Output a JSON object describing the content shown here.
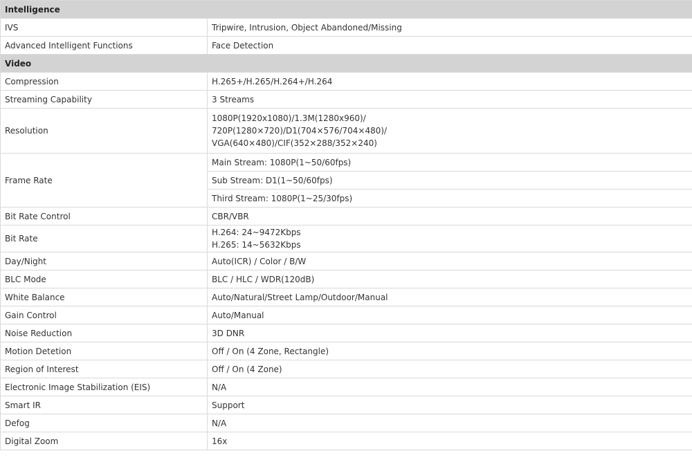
{
  "sections": {
    "intelligence": {
      "title": "Intelligence",
      "rows": [
        {
          "label": "IVS",
          "value": "Tripwire, Intrusion, Object Abandoned/Missing"
        },
        {
          "label": "Advanced Intelligent Functions",
          "value": "Face Detection"
        }
      ]
    },
    "video": {
      "title": "Video",
      "compression": {
        "label": "Compression",
        "value": "H.265+/H.265/H.264+/H.264"
      },
      "streaming": {
        "label": "Streaming Capability",
        "value": "3 Streams"
      },
      "resolution": {
        "label": "Resolution",
        "lines": [
          "1080P(1920x1080)/1.3M(1280x960)/",
          "720P(1280×720)/D1(704×576/704×480)/",
          "VGA(640×480)/CIF(352×288/352×240)"
        ]
      },
      "frame_rate": {
        "label": "Frame Rate",
        "values": [
          "Main Stream: 1080P(1~50/60fps)",
          "Sub Stream: D1(1~50/60fps)",
          "Third Stream: 1080P(1~25/30fps)"
        ]
      },
      "bit_rate_control": {
        "label": "Bit Rate Control",
        "value": "CBR/VBR"
      },
      "bit_rate": {
        "label": "Bit Rate",
        "lines": [
          "H.264: 24~9472Kbps",
          "H.265: 14~5632Kbps"
        ]
      },
      "rows": [
        {
          "label": "Day/Night",
          "value": "Auto(ICR) / Color / B/W"
        },
        {
          "label": "BLC Mode",
          "value": "BLC / HLC / WDR(120dB)"
        },
        {
          "label": "White Balance",
          "value": "Auto/Natural/Street Lamp/Outdoor/Manual"
        },
        {
          "label": "Gain Control",
          "value": "Auto/Manual"
        },
        {
          "label": "Noise Reduction",
          "value": "3D DNR"
        },
        {
          "label": "Motion Detetion",
          "value": "Off / On (4 Zone, Rectangle)"
        },
        {
          "label": "Region of Interest",
          "value": "Off / On (4 Zone)"
        },
        {
          "label": "Electronic Image Stabilization (EIS)",
          "value": "N/A"
        },
        {
          "label": "Smart IR",
          "value": "Support"
        },
        {
          "label": "Defog",
          "value": "N/A"
        },
        {
          "label": "Digital Zoom",
          "value": "16x"
        }
      ]
    }
  }
}
